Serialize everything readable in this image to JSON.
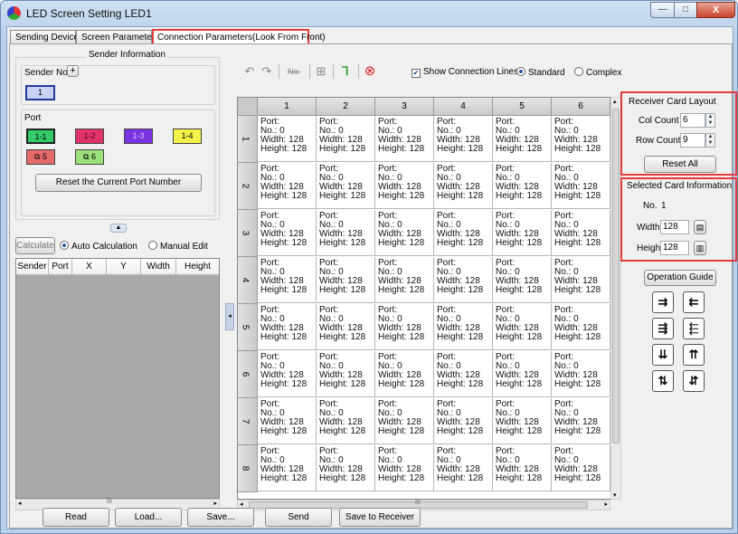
{
  "window": {
    "title": "LED Screen Setting LED1",
    "controls": {
      "minimize": "—",
      "maximize": "□",
      "close": "X"
    }
  },
  "tabs": [
    "Sending Device",
    "Screen Parameters",
    "Connection Parameters(Look From Front)"
  ],
  "sender": {
    "group_title": "Sender Information",
    "sender_no_label": "Sender No.",
    "add_symbol": "+",
    "sender_value": "1",
    "port_label": "Port",
    "ports": [
      {
        "label": "1-1",
        "color": "#33cc66"
      },
      {
        "label": "1-2",
        "color": "#e0336a"
      },
      {
        "label": "1-3",
        "color": "#7a33e0"
      },
      {
        "label": "1-4",
        "color": "#f2f24a"
      },
      {
        "label": "5",
        "color": "#e46a6a"
      },
      {
        "label": "6",
        "color": "#9be07a"
      }
    ],
    "reset_port_label": "Reset the Current Port Number",
    "calculate_label": "Calculate",
    "auto_calc_label": "Auto Calculation",
    "manual_edit_label": "Manual Edit",
    "list_columns": [
      "Sender",
      "Port",
      "X",
      "Y",
      "Width",
      "Height"
    ]
  },
  "toolbar": {
    "show_lines_label": "Show Connection Lines",
    "standard_label": "Standard",
    "complex_label": "Complex",
    "no_label": "No."
  },
  "grid": {
    "columns": [
      "1",
      "2",
      "3",
      "4",
      "5",
      "6"
    ],
    "rows": [
      "1",
      "2",
      "3",
      "4",
      "5",
      "6",
      "7",
      "8"
    ],
    "cell": {
      "port": "Port:",
      "no": "No.: 0",
      "width": "Width: 128",
      "height": "Height: 128"
    }
  },
  "layout": {
    "title": "Receiver Card Layout",
    "col_count_label": "Col Count",
    "col_count": "6",
    "row_count_label": "Row Count",
    "row_count": "9",
    "reset_all_label": "Reset All"
  },
  "selected": {
    "title": "Selected Card Information",
    "no_label": "No.",
    "no_value": "1",
    "width_label": "Width",
    "width_value": "128",
    "height_label": "Height",
    "height_value": "128"
  },
  "operation_guide_label": "Operation Guide",
  "bottom_buttons": [
    "Read",
    "Load...",
    "Save...",
    "Send",
    "Save to Receiver"
  ],
  "scroll_mark": "III"
}
